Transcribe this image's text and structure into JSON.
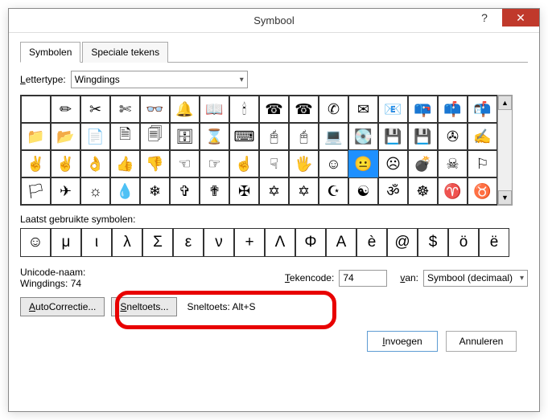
{
  "title": "Symbool",
  "tabs": {
    "symbols": "Symbolen",
    "special": "Speciale tekens"
  },
  "font": {
    "label_prefix_u": "L",
    "label_rest": "ettertype:",
    "value": "Wingdings"
  },
  "grid": {
    "rows": [
      [
        "",
        "✏",
        "✂",
        "✄",
        "👓",
        "🔔",
        "📖",
        "🕯",
        "☎",
        "☎",
        "✆",
        "✉",
        "📧",
        "📪",
        "📫",
        "📬"
      ],
      [
        "📁",
        "📂",
        "📄",
        "🗎",
        "🗐",
        "🗄",
        "⌛",
        "⌨",
        "🖰",
        "🖰",
        "💻",
        "💽",
        "💾",
        "💾",
        "✇",
        "✍"
      ],
      [
        "✌",
        "✌",
        "👌",
        "👍",
        "👎",
        "☜",
        "☞",
        "☝",
        "☟",
        "🖐",
        "☺",
        "😐",
        "☹",
        "💣",
        "☠",
        "⚐"
      ],
      [
        "🏳",
        "✈",
        "☼",
        "💧",
        "❄",
        "✞",
        "✟",
        "✠",
        "✡",
        "✡",
        "☪",
        "☯",
        "ॐ",
        "☸",
        "♈",
        "♉"
      ]
    ],
    "selected": {
      "row": 2,
      "col": 11
    }
  },
  "recent": {
    "label": "Laatst gebruikte symbolen:",
    "items": [
      "☺",
      "μ",
      "ι",
      "λ",
      "Σ",
      "ε",
      "ν",
      "+",
      "Λ",
      "Φ",
      "Α",
      "è",
      "@",
      "$",
      "ö",
      "ë"
    ]
  },
  "unicode": {
    "name_label": "Unicode-naam:",
    "name_value": "Wingdings: 74",
    "code_label_u": "T",
    "code_label_rest": "ekencode:",
    "code_value": "74",
    "from_label_u": "v",
    "from_label_rest": "an:",
    "from_value": "Symbool (decimaal)"
  },
  "buttons": {
    "autocorrect_u": "A",
    "autocorrect_rest": "utoCorrectie...",
    "shortcut_u": "S",
    "shortcut_rest": "neltoets...",
    "shortcut_display": "Sneltoets: Alt+S",
    "insert_u": "I",
    "insert_rest": "nvoegen",
    "cancel": "Annuleren"
  },
  "help_glyph": "?",
  "close_glyph": "✕"
}
